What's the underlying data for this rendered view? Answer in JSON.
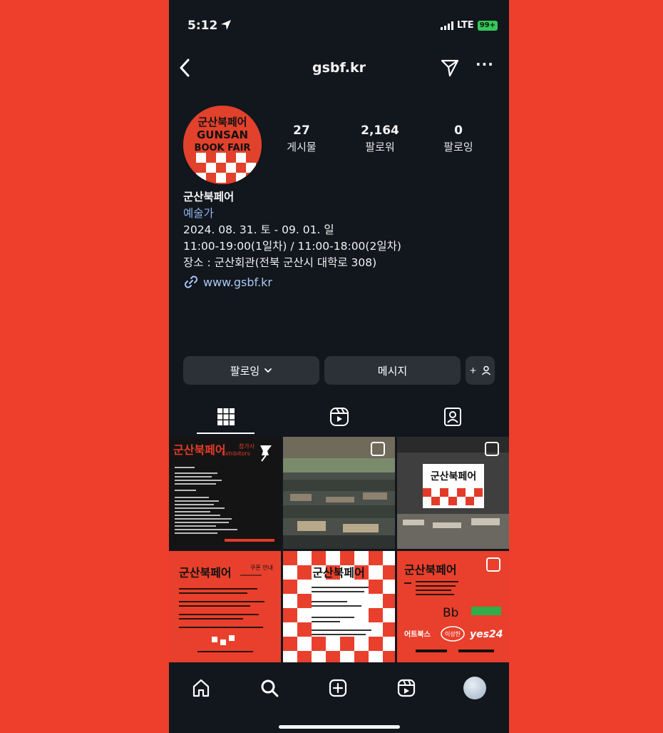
{
  "status_bar": {
    "time": "5:12",
    "network": "LTE",
    "battery": "99+"
  },
  "header": {
    "username": "gsbf.kr"
  },
  "profile": {
    "avatar_text": [
      "군산북페어",
      "GUNSAN",
      "BOOK FAIR"
    ],
    "stats": [
      {
        "value": "27",
        "label": "게시물"
      },
      {
        "value": "2,164",
        "label": "팔로워"
      },
      {
        "value": "0",
        "label": "팔로잉"
      }
    ],
    "name": "군산북페어",
    "category": "예술가",
    "bio_lines": [
      "2024. 08. 31. 토 - 09. 01. 일",
      "11:00-19:00(1일차) / 11:00-18:00(2일차)",
      "장소 : 군산회관(전북 군산시 대학로 308)"
    ],
    "link": "www.gsbf.kr"
  },
  "actions": {
    "following": "팔로잉",
    "message": "메시지",
    "add_person": "+"
  },
  "posts": {
    "p1": {
      "title": "군산북페어",
      "subtitle": "참가사",
      "subtitle_en": "Exhibitors"
    },
    "p3": {
      "banner": "군산북페어"
    },
    "p4": {
      "title": "군산북페어",
      "subtitle": "쿠폰 안내"
    },
    "p5": {
      "title": "군산북페어"
    },
    "p6": {
      "title": "군산북페어",
      "sponsors": [
        "Bb",
        "어트북스",
        "이상한",
        "yes24"
      ]
    }
  },
  "colors": {
    "accent_red": "#ee3f2d",
    "phone_bg": "#12161d",
    "button_bg": "#2c3138",
    "link_blue": "#a9c8f5"
  }
}
